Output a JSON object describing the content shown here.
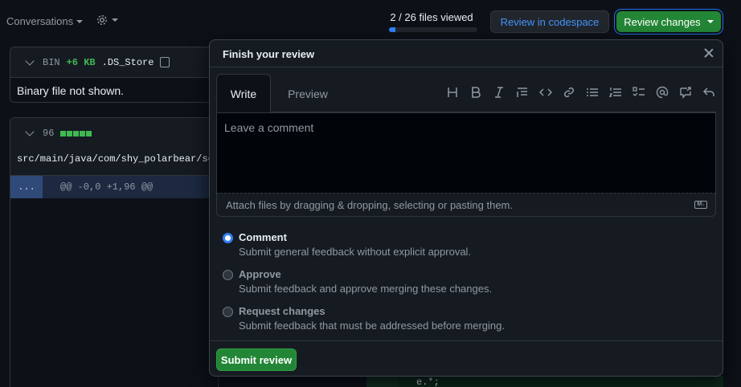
{
  "toolbar": {
    "conversations_label": "Conversations",
    "files_viewed": "2 / 26 files viewed",
    "files_viewed_fraction": 0.077,
    "codespace_label": "Review in codespace",
    "review_changes_label": "Review changes",
    "accent": "#238636",
    "link_color": "#4493f8"
  },
  "files": {
    "ds_store": {
      "bin_label": "BIN",
      "size_label": "+6 KB",
      "name": ".DS_Store",
      "message": "Binary file not shown."
    },
    "java": {
      "count": "96",
      "path": "src/main/java/com/shy_polarbear/se",
      "expand_label": "...",
      "hunk_header": "@@ -0,0 +1,96 @@"
    },
    "bg_code_line": "e.*;"
  },
  "dialog": {
    "title": "Finish your review",
    "tabs": [
      "Write",
      "Preview"
    ],
    "active_tab": "Write",
    "toolbar_icons": [
      "heading-icon",
      "bold-icon",
      "italic-icon",
      "quote-icon",
      "code-icon",
      "link-icon",
      "bullet-list-icon",
      "numbered-list-icon",
      "task-list-icon",
      "mention-icon",
      "reference-icon",
      "undo-icon"
    ],
    "comment_placeholder": "Leave a comment",
    "attach_hint": "Attach files by dragging & dropping, selecting or pasting them.",
    "options": [
      {
        "label": "Comment",
        "description": "Submit general feedback without explicit approval.",
        "selected": true
      },
      {
        "label": "Approve",
        "description": "Submit feedback and approve merging these changes.",
        "selected": false
      },
      {
        "label": "Request changes",
        "description": "Submit feedback that must be addressed before merging.",
        "selected": false
      }
    ],
    "submit_label": "Submit review"
  }
}
